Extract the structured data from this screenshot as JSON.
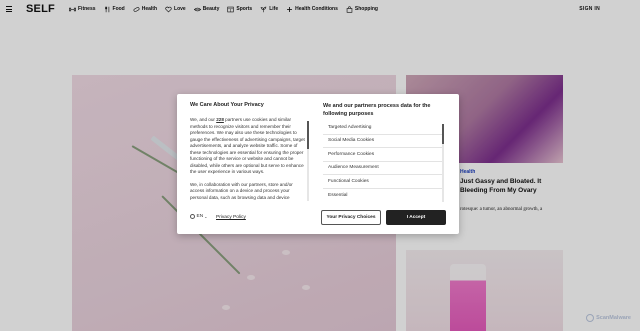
{
  "header": {
    "logo": "SELF",
    "nav": [
      {
        "label": "Fitness",
        "icon": "dumbbell-icon"
      },
      {
        "label": "Food",
        "icon": "fork-knife-icon"
      },
      {
        "label": "Health",
        "icon": "pill-icon"
      },
      {
        "label": "Love",
        "icon": "heart-icon"
      },
      {
        "label": "Beauty",
        "icon": "lips-icon"
      },
      {
        "label": "Sports",
        "icon": "scoreboard-icon"
      },
      {
        "label": "Life",
        "icon": "plant-icon"
      },
      {
        "label": "Health Conditions",
        "icon": "cross-icon"
      },
      {
        "label": "Shopping",
        "icon": "bag-icon"
      }
    ],
    "sign_in": "SIGN IN"
  },
  "side_article": {
    "tag": "Health",
    "title": "Just Gassy and Bloated. It Bleeding From My Ovary",
    "snippet": "rotesque: a tumor, an abnormal growth, a"
  },
  "consent": {
    "left_title": "We Care About Your Privacy",
    "paragraph1_pre": "We, and our ",
    "partners_count": "228",
    "paragraph1_post": " partners use cookies and similar methods to recognize visitors and remember their preferences. We may also use these technologies to gauge the effectiveness of advertising campaigns, target advertisements, and analyze website traffic. Some of these technologies are essential for ensuring the proper functioning of the service or website and cannot be disabled, while others are optional but serve to enhance the user experience in various ways.",
    "paragraph2": "We, in collaboration with our partners, store and/or access information on a device and process your personal data, such as browsing data and device",
    "language": "EN",
    "privacy_policy": "Privacy Policy",
    "right_title": "We and our partners process data for the following purposes",
    "purposes": [
      "Targeted Advertising",
      "Social Media Cookies",
      "Performance Cookies",
      "Audience Measurement",
      "Functional Cookies",
      "Essential"
    ],
    "choices_button": "Your Privacy Choices",
    "accept_button": "I Accept"
  },
  "watermark": "ScanMalware",
  "colors": {
    "accent": "#1b3dbd",
    "accept_bg": "#222222"
  }
}
